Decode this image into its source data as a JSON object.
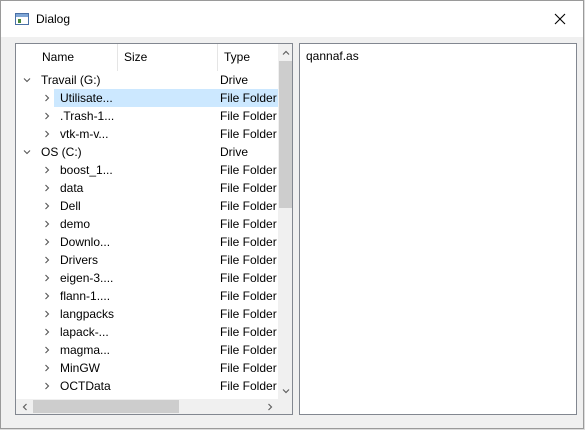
{
  "window": {
    "title": "Dialog"
  },
  "tree": {
    "columns": {
      "name": "Name",
      "size": "Size",
      "type": "Type"
    },
    "rows": [
      {
        "name": "Travail (G:)",
        "type": "Drive",
        "level": 0,
        "expanded": true
      },
      {
        "name": "Utilisate...",
        "type": "File Folder",
        "level": 1,
        "selected": true
      },
      {
        "name": ".Trash-1...",
        "type": "File Folder",
        "level": 1
      },
      {
        "name": "vtk-m-v...",
        "type": "File Folder",
        "level": 1
      },
      {
        "name": "OS (C:)",
        "type": "Drive",
        "level": 0,
        "expanded": true
      },
      {
        "name": "boost_1...",
        "type": "File Folder",
        "level": 1
      },
      {
        "name": "data",
        "type": "File Folder",
        "level": 1
      },
      {
        "name": "Dell",
        "type": "File Folder",
        "level": 1
      },
      {
        "name": "demo",
        "type": "File Folder",
        "level": 1
      },
      {
        "name": "Downlo...",
        "type": "File Folder",
        "level": 1
      },
      {
        "name": "Drivers",
        "type": "File Folder",
        "level": 1
      },
      {
        "name": "eigen-3....",
        "type": "File Folder",
        "level": 1
      },
      {
        "name": "flann-1....",
        "type": "File Folder",
        "level": 1
      },
      {
        "name": "langpacks",
        "type": "File Folder",
        "level": 1
      },
      {
        "name": "lapack-...",
        "type": "File Folder",
        "level": 1
      },
      {
        "name": "magma...",
        "type": "File Folder",
        "level": 1
      },
      {
        "name": "MinGW",
        "type": "File Folder",
        "level": 1
      },
      {
        "name": "OCTData",
        "type": "File Folder",
        "level": 1
      }
    ]
  },
  "text_panel": {
    "content": "qannaf.as"
  }
}
